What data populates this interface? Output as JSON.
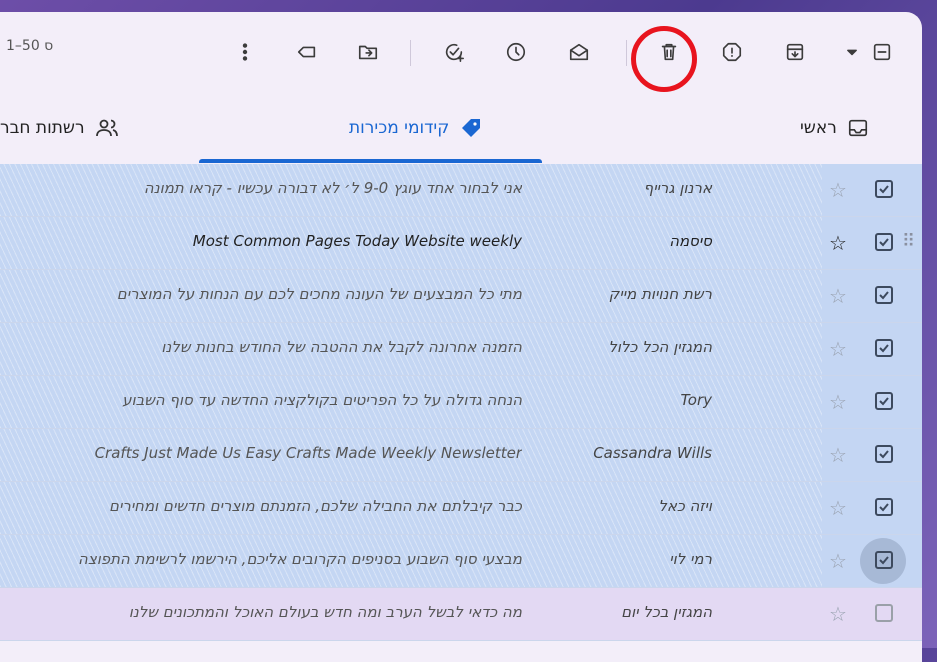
{
  "toolbar": {
    "range_text": "1–50 ס",
    "icons": [
      "select-checkbox",
      "select-dropdown",
      "archive",
      "report-spam",
      "delete",
      "mark-as-read",
      "snooze",
      "add-to-tasks",
      "move-to",
      "label",
      "more"
    ]
  },
  "tabs": {
    "primary": "ראשי",
    "promotions": "קידומי מכירות",
    "social": "רשתות חבר"
  },
  "emails": [
    {
      "sender": "ארנון גרייף",
      "subject": "אני לבחור אחד עוגץ 9-0 ל׳ לא דבורה עכשיו - קראו תמונה",
      "selected": true,
      "starred": false
    },
    {
      "sender": "סיסמה",
      "subject": "Most Common Pages Today Website weekly",
      "selected": true,
      "starred": true,
      "hover": true
    },
    {
      "sender": "רשת חנויות מייק",
      "subject": "מתי כל המבצעים של העונה מחכים לכם עם הנחות על המוצרים",
      "selected": true,
      "starred": false
    },
    {
      "sender": "המגזין הכל כלול",
      "subject": "הזמנה אחרונה לקבל את ההטבה של החודש בחנות שלנו",
      "selected": true,
      "starred": false
    },
    {
      "sender": "Tory",
      "subject": "הנחה גדולה על כל הפריטים בקולקציה החדשה עד סוף השבוע",
      "selected": true,
      "starred": false
    },
    {
      "sender": "Cassandra Wills",
      "subject": "Crafts Just Made Us Easy Crafts Made Weekly Newsletter",
      "selected": true,
      "starred": false
    },
    {
      "sender": "ויזה כאל",
      "subject": "כבר קיבלתם את החבילה שלכם, הזמנתם מוצרים חדשים ומחירים",
      "selected": true,
      "starred": false
    },
    {
      "sender": "רמי לוי",
      "subject": "מבצעי סוף השבוע בסניפים הקרובים אליכם, הירשמו לרשימת התפוצה",
      "selected": true,
      "starred": false,
      "focus": true
    },
    {
      "sender": "המגזין בכל יום",
      "subject": "מה כדאי לבשל הערב ומה חדש בעולם האוכל והמתכונים שלנו",
      "selected": false,
      "starred": false
    }
  ],
  "colors": {
    "accent": "#1a67d2",
    "selected_row": "#c4d6f3",
    "highlight_circle": "#e8141e"
  }
}
